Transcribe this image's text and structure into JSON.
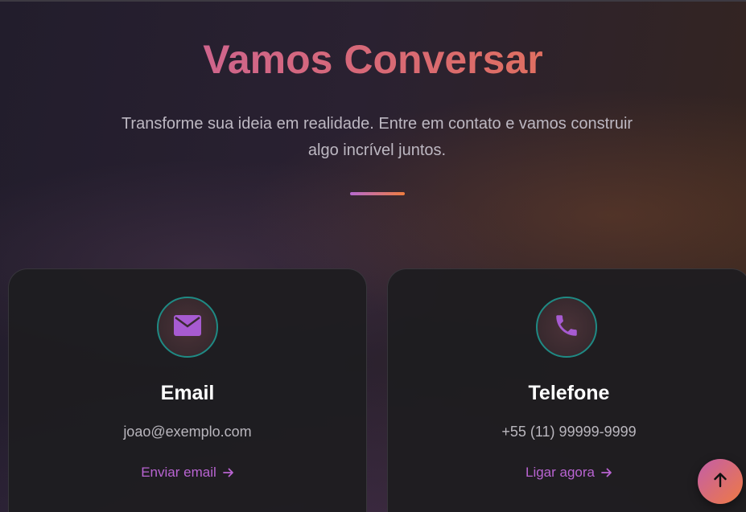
{
  "section": {
    "title": "Vamos Conversar",
    "subtitle": "Transforme sua ideia em realidade. Entre em contato e vamos construir algo incrível juntos."
  },
  "cards": [
    {
      "icon": "envelope-icon",
      "title": "Email",
      "value": "joao@exemplo.com",
      "link_label": "Enviar email"
    },
    {
      "icon": "phone-icon",
      "title": "Telefone",
      "value": "+55 (11) 99999-9999",
      "link_label": "Ligar agora"
    }
  ],
  "scroll_top": {
    "icon": "arrow-up-icon"
  },
  "colors": {
    "accent_purple": "#b964d2",
    "accent_orange": "#ef7a43",
    "icon_ring_teal": "#1f8a84"
  }
}
